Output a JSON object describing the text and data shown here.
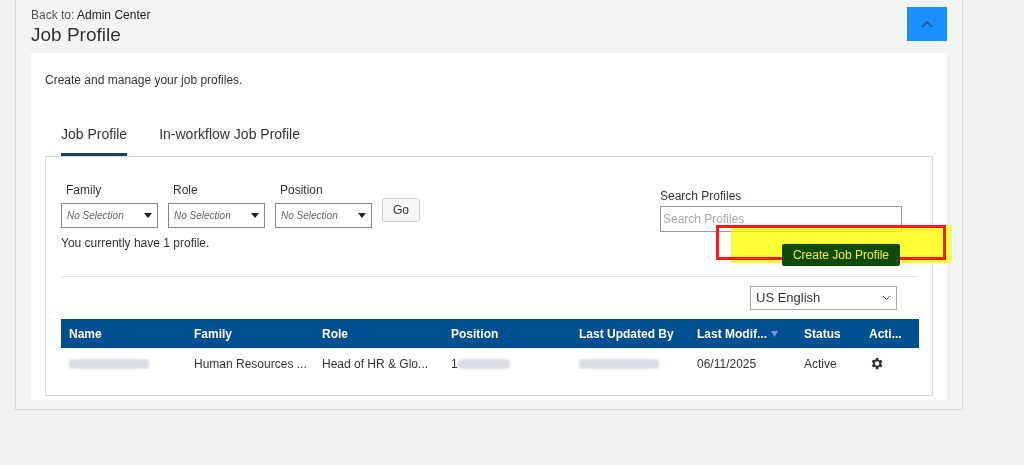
{
  "header": {
    "back_label": "Back to:",
    "back_link": "Admin Center",
    "title": "Job Profile",
    "collapsed": false
  },
  "intro": "Create and manage your job profiles.",
  "tabs": [
    {
      "label": "Job Profile",
      "selected": true
    },
    {
      "label": "In-workflow Job Profile",
      "selected": false
    }
  ],
  "filters": [
    {
      "label": "Family",
      "placeholder": "No Selection"
    },
    {
      "label": "Role",
      "placeholder": "No Selection"
    },
    {
      "label": "Position",
      "placeholder": "No Selection"
    }
  ],
  "go_button": "Go",
  "count_text": "You currently have 1 profile.",
  "search": {
    "label": "Search Profiles",
    "placeholder": "Search Profiles"
  },
  "create_button": "Create Job Profile",
  "highlighted": true,
  "language": "US English",
  "table": {
    "columns": [
      {
        "label": "Name",
        "sorted": false
      },
      {
        "label": "Family",
        "sorted": false
      },
      {
        "label": "Role",
        "sorted": false
      },
      {
        "label": "Position",
        "sorted": false
      },
      {
        "label": "Last Updated By",
        "sorted": false
      },
      {
        "label": "Last Modif...",
        "sorted": true
      },
      {
        "label": "Status",
        "sorted": false
      },
      {
        "label": "Acti...",
        "sorted": false
      }
    ],
    "rows": [
      {
        "cells": [
          {
            "kind": "redacted"
          },
          {
            "kind": "text",
            "text": "Human Resources ..."
          },
          {
            "kind": "text",
            "text": "Head of HR & Glo..."
          },
          {
            "kind": "partial",
            "text": "1"
          },
          {
            "kind": "redacted"
          },
          {
            "kind": "text",
            "text": "06/11/2025"
          },
          {
            "kind": "text",
            "text": "Active"
          },
          {
            "kind": "gear"
          }
        ]
      }
    ]
  }
}
